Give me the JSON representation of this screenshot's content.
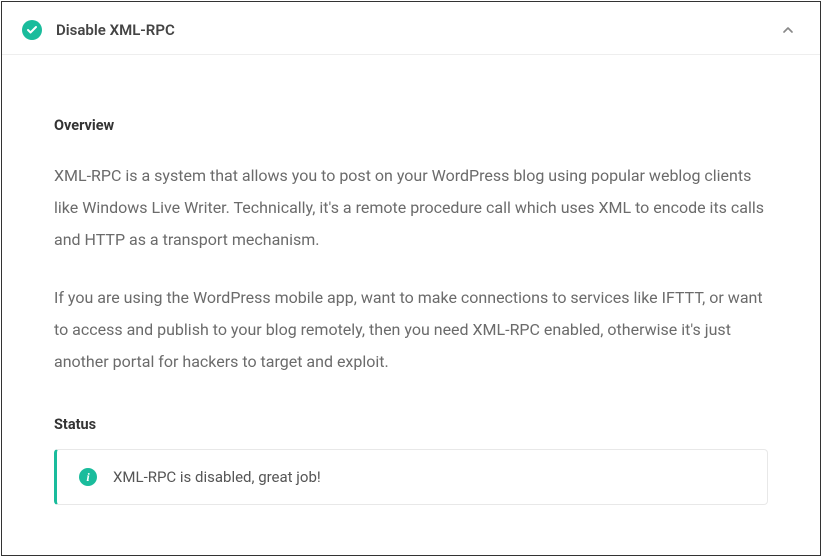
{
  "panel": {
    "title": "Disable XML-RPC",
    "status_icon": "check-circle"
  },
  "overview": {
    "heading": "Overview",
    "paragraph1": "XML-RPC is a system that allows you to post on your WordPress blog using popular weblog clients like Windows Live Writer. Technically, it's a remote procedure call which uses XML to encode its calls and HTTP as a transport mechanism.",
    "paragraph2": "If you are using the WordPress mobile app, want to make connections to services like IFTTT, or want to access and publish to your blog remotely, then you need XML-RPC enabled, otherwise it's just another portal for hackers to target and exploit."
  },
  "status": {
    "heading": "Status",
    "message": "XML-RPC is disabled, great job!",
    "icon": "info"
  },
  "colors": {
    "accent": "#1abc9c"
  }
}
